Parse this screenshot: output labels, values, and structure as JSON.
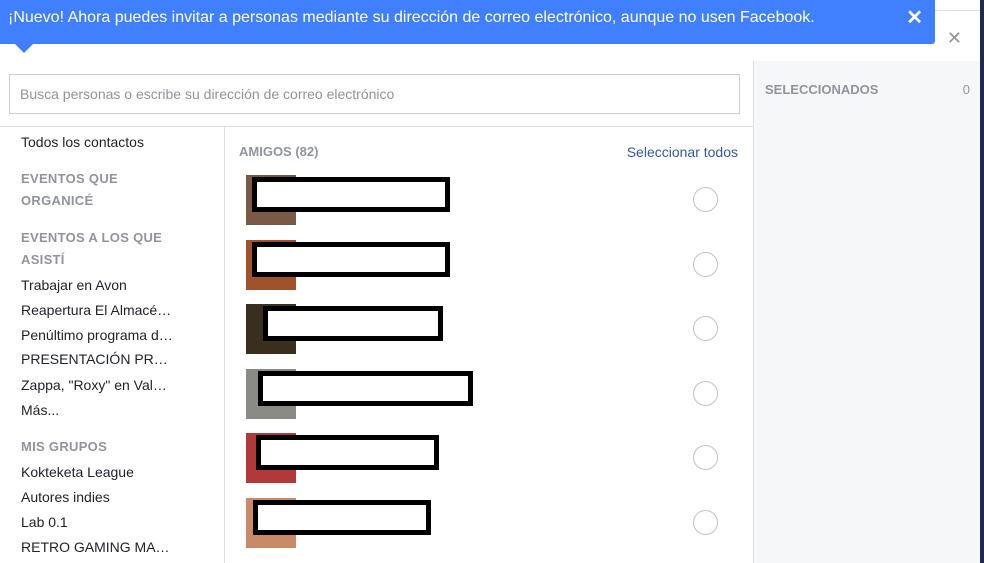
{
  "tooltip": {
    "text": "¡Nuevo! Ahora puedes invitar a personas mediante su dirección de correo electrónico, aunque no usen Facebook.",
    "close": "✕"
  },
  "dialog": {
    "close": "✕"
  },
  "search": {
    "placeholder": "Busca personas o escribe su dirección de correo electrónico"
  },
  "sidebar": {
    "all_contacts": "Todos los contactos",
    "events_organized_heading": "EVENTOS QUE ORGANICÉ",
    "events_attended_heading": "EVENTOS A LOS QUE ASISTÍ",
    "events": [
      "Trabajar en Avon",
      "Reapertura El Almacé…",
      "Penúltimo programa d…",
      "PRESENTACIÓN PR…",
      "Zappa, \"Roxy\" en Val…"
    ],
    "more": "Más...",
    "groups_heading": "MIS GRUPOS",
    "groups": [
      "Kokteketa League",
      "Autores indies",
      "Lab 0.1",
      "RETRO GAMING MA…"
    ]
  },
  "friends": {
    "heading": "AMIGOS (82)",
    "select_all": "Seleccionar todos"
  },
  "selected": {
    "label": "SELECCIONADOS",
    "count": "0"
  },
  "colors": {
    "tooltip_bg": "#4080ff",
    "link": "#365899",
    "muted": "#90949c"
  }
}
